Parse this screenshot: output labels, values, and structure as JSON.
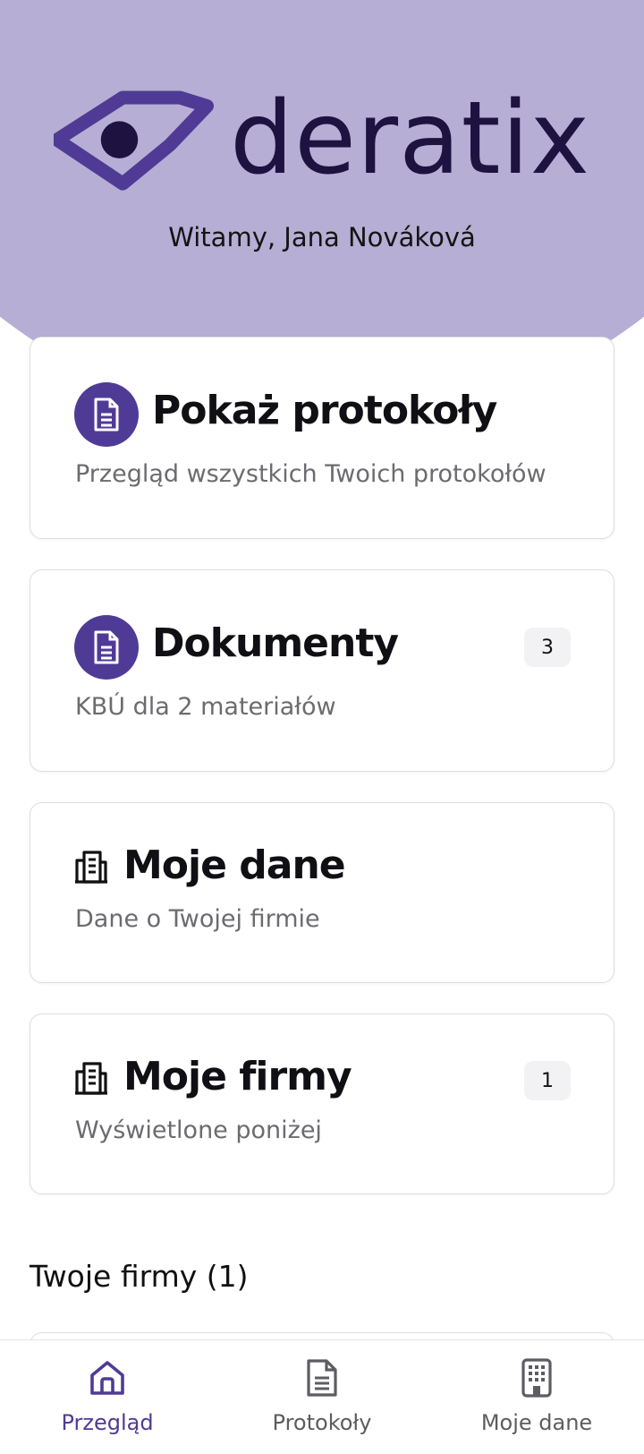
{
  "brand": {
    "name": "deratix",
    "accent": "#4f3b95",
    "hero_bg": "#b6aed4"
  },
  "welcome": "Witamy, Jana Nováková",
  "cards": [
    {
      "title": "Pokaż protokoły",
      "subtitle": "Przegląd wszystkich Twoich protokołów",
      "icon": "document-icon"
    },
    {
      "title": "Dokumenty",
      "subtitle": "KBÚ dla 2 materiałów",
      "badge": "3",
      "icon": "document-icon"
    },
    {
      "title": "Moje dane",
      "subtitle": "Dane o Twojej firmie",
      "icon": "building-icon"
    },
    {
      "title": "Moje firmy",
      "subtitle": "Wyświetlone poniżej",
      "badge": "1",
      "icon": "building-icon"
    }
  ],
  "section": {
    "title": "Twoje firmy (1)"
  },
  "bottom_nav": [
    {
      "label": "Przegląd",
      "icon": "home-icon",
      "active": true
    },
    {
      "label": "Protokoły",
      "icon": "document-icon",
      "active": false
    },
    {
      "label": "Moje dane",
      "icon": "building-icon",
      "active": false
    }
  ]
}
